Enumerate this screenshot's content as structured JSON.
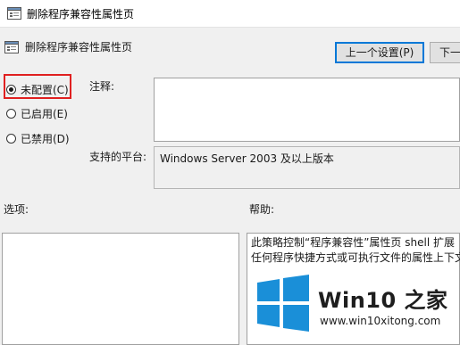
{
  "window": {
    "title": "删除程序兼容性属性页",
    "icon": "policy-setting-icon"
  },
  "header": {
    "title": "删除程序兼容性属性页",
    "icon": "policy-setting-icon"
  },
  "nav": {
    "prev_label": "上一个设置(P)",
    "next_label": "下一"
  },
  "options": {
    "not_configured": "未配置(C)",
    "enabled": "已启用(E)",
    "disabled": "已禁用(D)",
    "selected": "not_configured"
  },
  "fields": {
    "comment_label": "注释:",
    "comment_value": "",
    "platform_label": "支持的平台:",
    "platform_value": "Windows Server 2003 及以上版本"
  },
  "sections": {
    "options_label": "选项:",
    "help_label": "帮助:"
  },
  "help": {
    "line1": "此策略控制“程序兼容性”属性页 shell 扩展",
    "line2": "任何程序快捷方式或可执行文件的属性上下文"
  },
  "watermark": {
    "brand": "Win10 之家",
    "url": "www.win10xitong.com",
    "colors": {
      "logo": "#1a8fd8",
      "text": "#1e1e1e"
    }
  },
  "colors": {
    "highlight": "#e02020",
    "button_border_focus": "#0078d7",
    "background": "#f0f0f0"
  }
}
